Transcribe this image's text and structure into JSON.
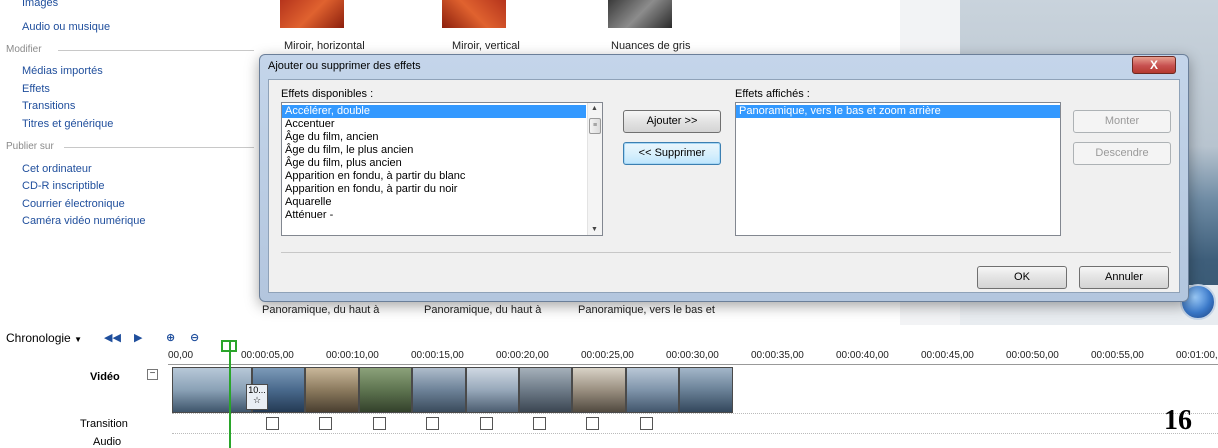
{
  "taskpane": {
    "top_items": [
      "Images",
      "Audio ou musique"
    ],
    "sections": [
      {
        "title": "Modifier",
        "items": [
          "Médias importés",
          "Effets",
          "Transitions",
          "Titres et générique"
        ]
      },
      {
        "title": "Publier sur",
        "items": [
          "Cet ordinateur",
          "CD-R inscriptible",
          "Courrier électronique",
          "Caméra vidéo numérique"
        ]
      }
    ]
  },
  "effects_gallery": {
    "captions": [
      "Miroir, horizontal",
      "Miroir, vertical",
      "Nuances de gris"
    ],
    "bottom_captions": [
      "Panoramique, du haut à",
      "Panoramique, du haut à",
      "Panoramique, vers le bas et"
    ]
  },
  "dialog": {
    "title": "Ajouter ou supprimer des effets",
    "close_label": "X",
    "available_label": "Effets disponibles :",
    "available_items": [
      "Accélérer, double",
      "Accentuer",
      "Âge du film, ancien",
      "Âge du film, le plus ancien",
      "Âge du film, plus ancien",
      "Apparition en fondu, à partir du blanc",
      "Apparition en fondu, à partir du noir",
      "Aquarelle",
      "Atténuer -"
    ],
    "available_selected_index": 0,
    "add_button": "Ajouter >>",
    "remove_button": "<< Supprimer",
    "displayed_label": "Effets affichés :",
    "displayed_items": [
      "Panoramique, vers le bas et zoom arrière"
    ],
    "displayed_selected_index": 0,
    "up_button": "Monter",
    "down_button": "Descendre",
    "ok_button": "OK",
    "cancel_button": "Annuler"
  },
  "timeline": {
    "label": "Chronologie",
    "ruler_ticks": [
      "00,00",
      "00:00:05,00",
      "00:00:10,00",
      "00:00:15,00",
      "00:00:20,00",
      "00:00:25,00",
      "00:00:30,00",
      "00:00:35,00",
      "00:00:40,00",
      "00:00:45,00",
      "00:00:50,00",
      "00:00:55,00",
      "00:01:00,0"
    ],
    "tracks": {
      "video": "Vidéo",
      "transition": "Transition",
      "audio": "Audio"
    },
    "clip_badge": "10...",
    "clip_count": 10,
    "transition_count": 8
  },
  "page_number": "16",
  "colors": {
    "link": "#1f4e9c",
    "selection": "#3399ff",
    "playhead": "#2aa52a"
  }
}
